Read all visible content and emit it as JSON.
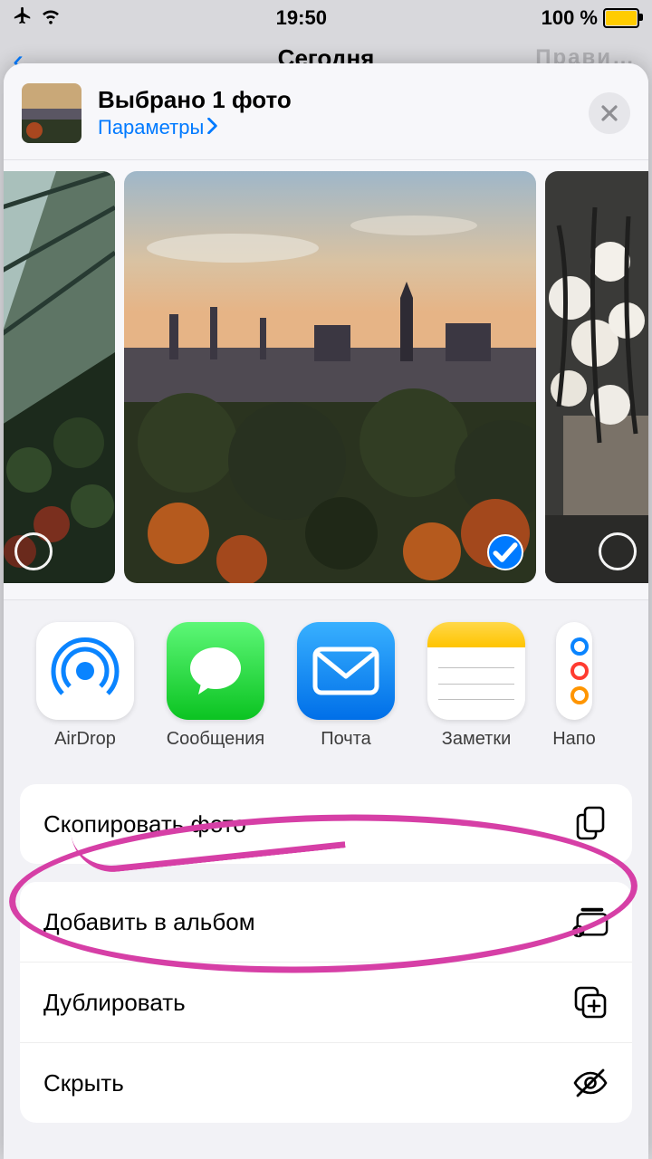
{
  "status": {
    "time": "19:50",
    "battery_text": "100 %"
  },
  "background_nav": {
    "title": "Сегодня",
    "edit_hint": "Прави…"
  },
  "sheet_header": {
    "title": "Выбрано 1 фото",
    "subtitle": "Параметры"
  },
  "photos": [
    {
      "selected": false
    },
    {
      "selected": true
    },
    {
      "selected": false
    }
  ],
  "apps": [
    {
      "label": "AirDrop"
    },
    {
      "label": "Сообщения"
    },
    {
      "label": "Почта"
    },
    {
      "label": "Заметки"
    },
    {
      "label": "Напо"
    }
  ],
  "actions_group1": [
    {
      "label": "Скопировать фото",
      "icon": "copy"
    }
  ],
  "actions_group2": [
    {
      "label": "Добавить в альбом",
      "icon": "album-add"
    },
    {
      "label": "Дублировать",
      "icon": "duplicate"
    },
    {
      "label": "Скрыть",
      "icon": "hide"
    }
  ]
}
